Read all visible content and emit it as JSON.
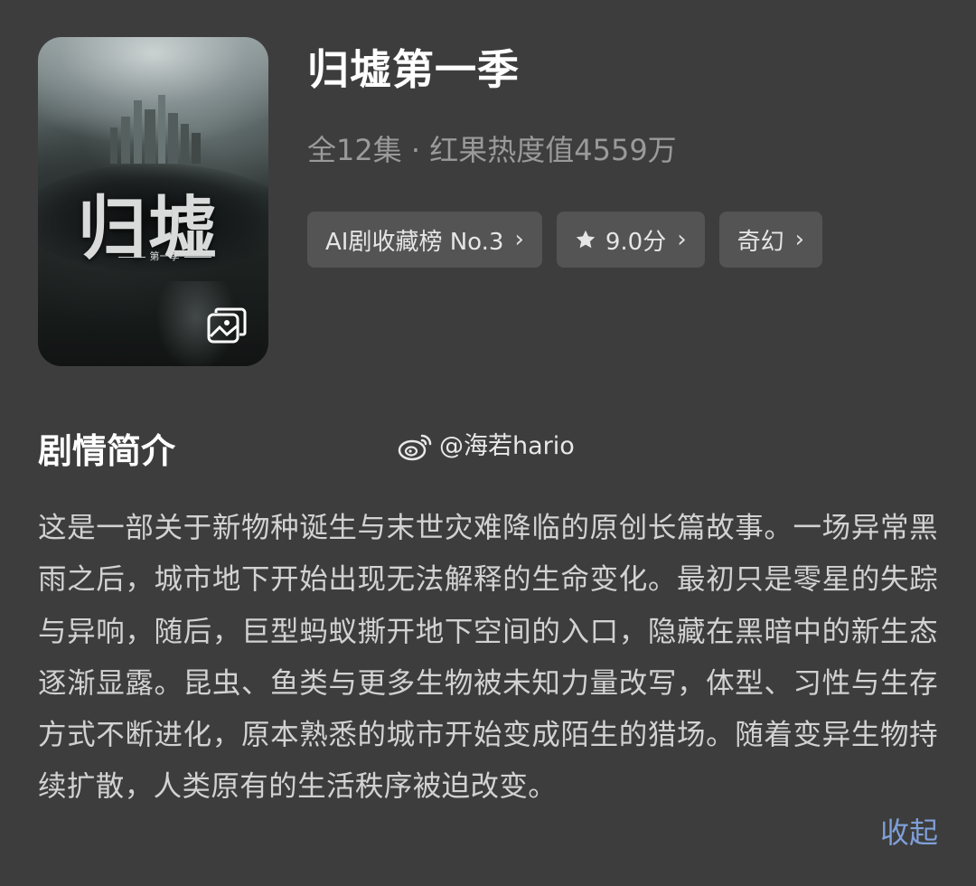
{
  "show": {
    "poster_logo": "归墟",
    "poster_subtitle": "第一季",
    "title": "归墟第一季",
    "meta": "全12集 · 红果热度值4559万"
  },
  "chips": [
    {
      "label": "AI剧收藏榜 No.3",
      "chevron": "›"
    },
    {
      "icon": "star-icon",
      "label": "9.0分",
      "chevron": "›"
    },
    {
      "label": "奇幻",
      "chevron": "›"
    }
  ],
  "synopsis": {
    "heading": "剧情简介",
    "watermark": "@海若hario",
    "text": "这是一部关于新物种诞生与末世灾难降临的原创长篇故事。一场异常黑雨之后，城市地下开始出现无法解释的生命变化。最初只是零星的失踪与异响，随后，巨型蚂蚁撕开地下空间的入口，隐藏在黑暗中的新生态逐渐显露。昆虫、鱼类与更多生物被未知力量改写，体型、习性与生存方式不断进化，原本熟悉的城市开始变成陌生的猎场。随着变异生物持续扩散，人类原有的生活秩序被迫改变。",
    "collapse_label": "收起"
  },
  "colors": {
    "background": "#3d3d3d",
    "chip_background": "#545454",
    "meta_text": "#9a9a9a",
    "link": "#7f9fd8"
  }
}
